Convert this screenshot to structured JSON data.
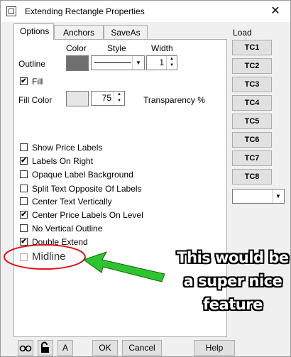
{
  "window": {
    "title": "Extending Rectangle Properties",
    "close_glyph": "✕"
  },
  "tabs": [
    {
      "label": "Options",
      "active": true
    },
    {
      "label": "Anchors"
    },
    {
      "label": "SaveAs"
    }
  ],
  "options": {
    "col_headers": {
      "color": "Color",
      "style": "Style",
      "width": "Width"
    },
    "outline_label": "Outline",
    "outline_color": "#6f6f6f",
    "outline_width": "1",
    "fill_label": "Fill",
    "fill_checked": true,
    "fill_color_label": "Fill Color",
    "fill_color": "#e6e6e6",
    "transparency_value": "75",
    "transparency_label": "Transparency %",
    "checkboxes": [
      {
        "label": "Show Price Labels",
        "checked": false
      },
      {
        "label": "Labels On Right",
        "checked": true
      },
      {
        "label": "Opaque Label Background",
        "checked": false
      },
      {
        "label": "Split Text Opposite Of Labels",
        "checked": false
      },
      {
        "label": "Center Text Vertically",
        "checked": false
      },
      {
        "label": "Center Price Labels On Level",
        "checked": true
      },
      {
        "label": "No Vertical Outline",
        "checked": false
      },
      {
        "label": "Double Extend",
        "checked": true
      }
    ],
    "midline_label": "Midline"
  },
  "load": {
    "label": "Load",
    "buttons": [
      "TC1",
      "TC2",
      "TC3",
      "TC4",
      "TC5",
      "TC6",
      "TC7",
      "TC8"
    ]
  },
  "bottom": {
    "a_label": "A",
    "ok": "OK",
    "cancel": "Cancel",
    "help": "Help"
  },
  "annotation": {
    "lines": [
      "This would be",
      "a super nice",
      "feature"
    ],
    "arrow_color": "#2fc42f",
    "circle_color": "#e0141b"
  }
}
